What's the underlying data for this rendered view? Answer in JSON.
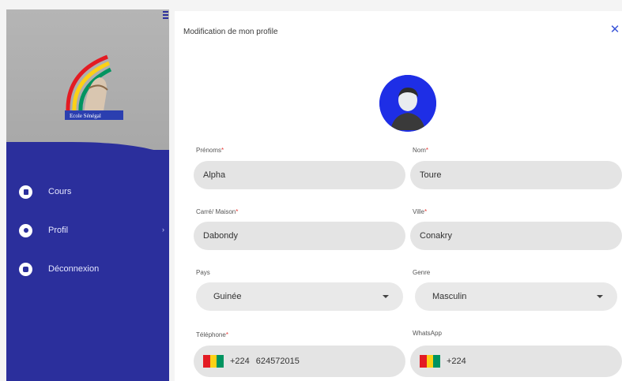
{
  "sidebar": {
    "items": [
      {
        "label": "Cours",
        "icon": "book-icon"
      },
      {
        "label": "Profil",
        "icon": "profile-icon"
      },
      {
        "label": "Déconnexion",
        "icon": "logout-icon"
      }
    ],
    "logo_text": "Ecole Sénégal",
    "accent": "#2b2f9c"
  },
  "panel": {
    "title": "Modification de mon profile",
    "close_icon": "close-icon"
  },
  "form": {
    "prenoms": {
      "label": "Prénoms",
      "value": "Alpha"
    },
    "nom": {
      "label": "Nom",
      "value": "Toure"
    },
    "carre": {
      "label": "Carré/ Maison",
      "value": "Dabondy"
    },
    "ville": {
      "label": "Ville",
      "value": "Conakry"
    },
    "pays": {
      "label": "Pays",
      "value": "Guinée"
    },
    "genre": {
      "label": "Genre",
      "value": "Masculin"
    },
    "telephone": {
      "label": "Téléphone",
      "code": "+224",
      "value": "624572015"
    },
    "whatsapp": {
      "label": "WhatsApp",
      "code": "+224",
      "value": ""
    }
  },
  "required_marker": "*"
}
